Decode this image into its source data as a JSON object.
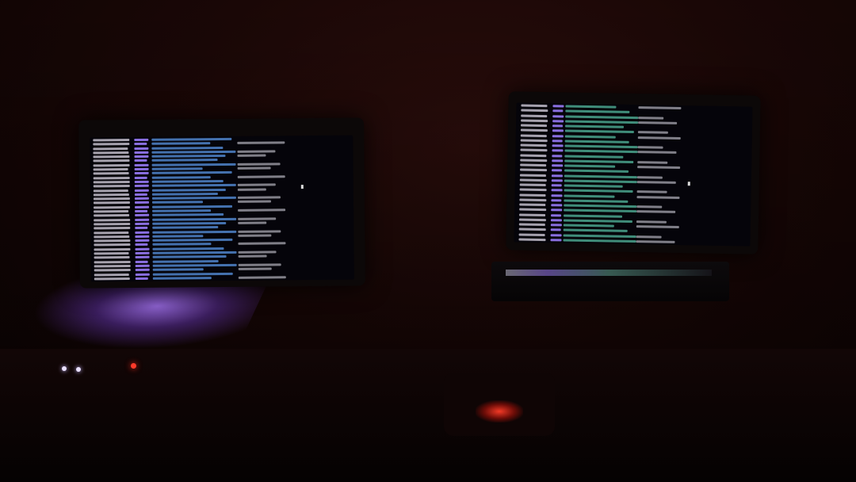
{
  "scene": {
    "objects": [
      "monitor-left",
      "monitor-right",
      "laptop-base",
      "purple-stand",
      "red-light"
    ]
  },
  "colors": {
    "wall": "#1a0706",
    "terminal_background": "#05040a",
    "terminal_text": "#dcd7e6",
    "terminal_tag": "#8a6fe0",
    "terminal_blue": "#5a96e6",
    "terminal_cyan": "#5ac8aa",
    "purple_light": "#aa78ff",
    "red_light": "#ff3c28"
  },
  "icons": {
    "cursor_left": "block-cursor",
    "cursor_right": "block-cursor"
  }
}
